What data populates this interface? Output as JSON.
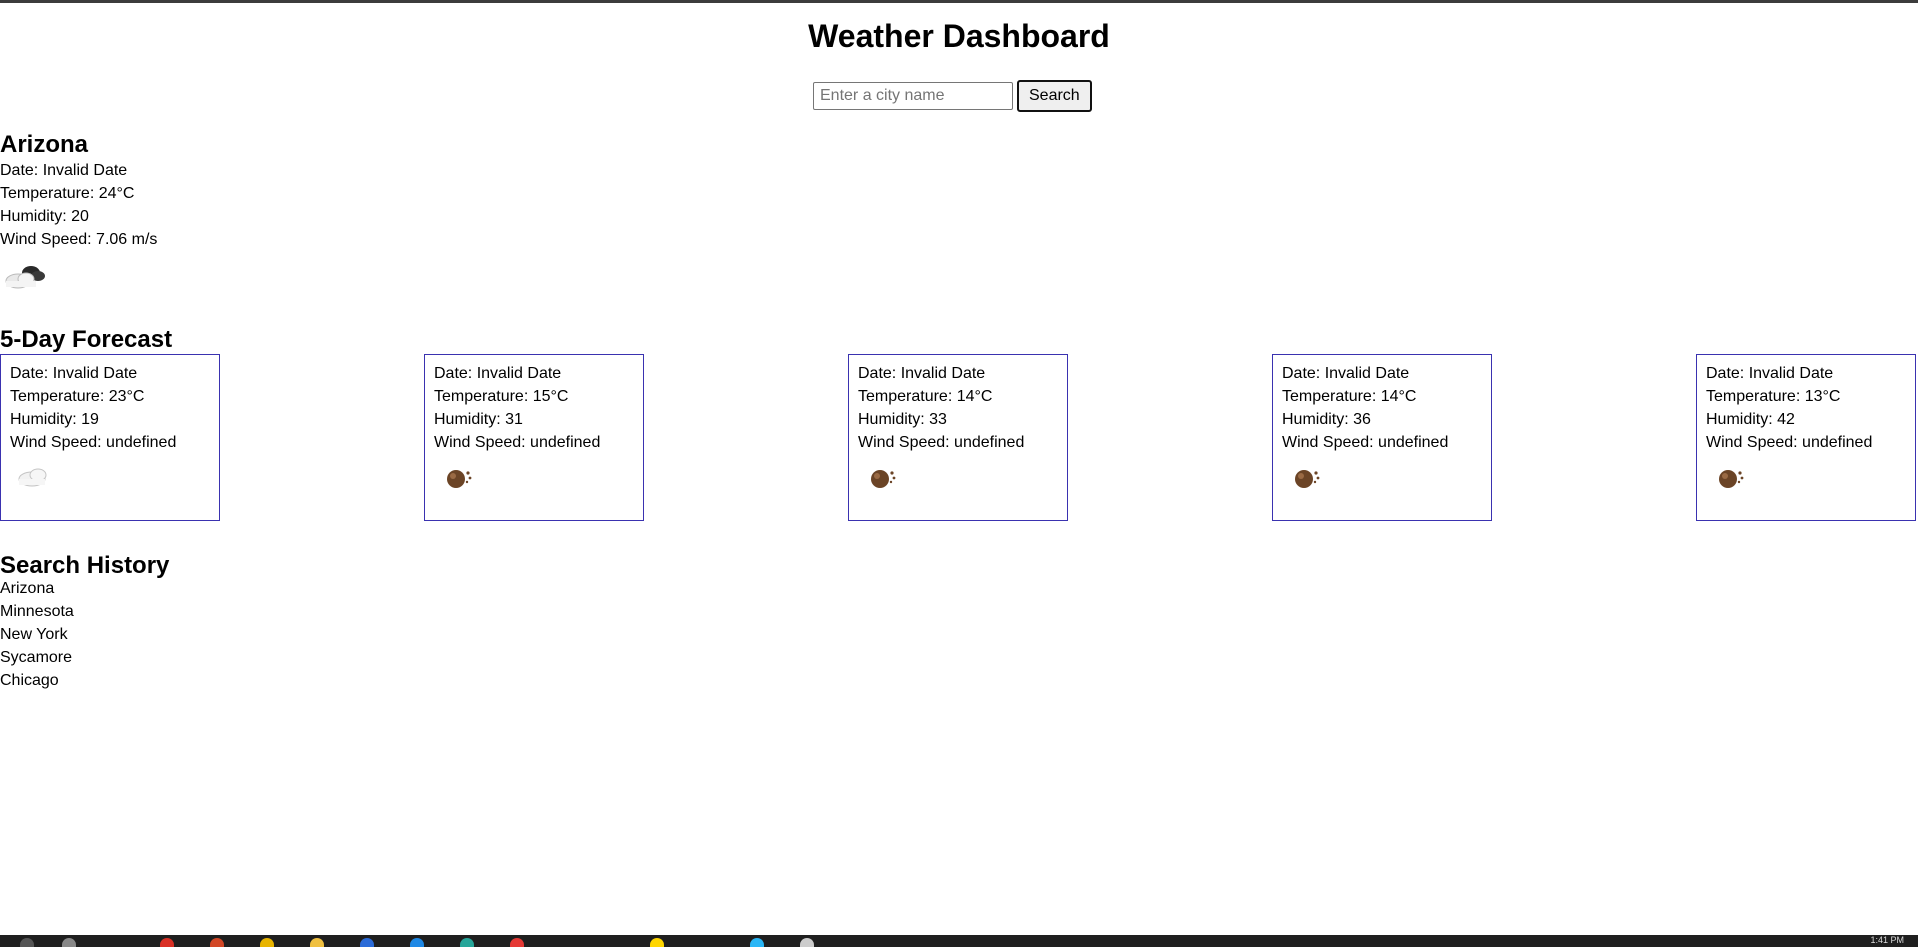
{
  "page_title": "Weather Dashboard",
  "search": {
    "placeholder": "Enter a city name",
    "button_label": "Search"
  },
  "current": {
    "city": "Arizona",
    "date": "Date: Invalid Date",
    "temperature": "Temperature: 24°C",
    "humidity": "Humidity: 20",
    "wind": "Wind Speed: 7.06 m/s",
    "icon": "cloud-sun-icon"
  },
  "forecast": {
    "heading": "5-Day Forecast",
    "days": [
      {
        "date": "Date: Invalid Date",
        "temperature": "Temperature: 23°C",
        "humidity": "Humidity: 19",
        "wind": "Wind Speed: undefined",
        "icon": "cloud-icon"
      },
      {
        "date": "Date: Invalid Date",
        "temperature": "Temperature: 15°C",
        "humidity": "Humidity: 31",
        "wind": "Wind Speed: undefined",
        "icon": "brown-ball-icon"
      },
      {
        "date": "Date: Invalid Date",
        "temperature": "Temperature: 14°C",
        "humidity": "Humidity: 33",
        "wind": "Wind Speed: undefined",
        "icon": "brown-ball-icon"
      },
      {
        "date": "Date: Invalid Date",
        "temperature": "Temperature: 14°C",
        "humidity": "Humidity: 36",
        "wind": "Wind Speed: undefined",
        "icon": "brown-ball-icon"
      },
      {
        "date": "Date: Invalid Date",
        "temperature": "Temperature: 13°C",
        "humidity": "Humidity: 42",
        "wind": "Wind Speed: undefined",
        "icon": "brown-ball-icon"
      }
    ]
  },
  "history": {
    "heading": "Search History",
    "items": [
      "Arizona",
      "Minnesota",
      "New York",
      "Sycamore",
      "Chicago"
    ]
  },
  "taskbar": {
    "clock": "1:41 PM"
  },
  "colors": {
    "card_border": "#3a32b0",
    "taskbar_bg": "#1f1f1f"
  }
}
